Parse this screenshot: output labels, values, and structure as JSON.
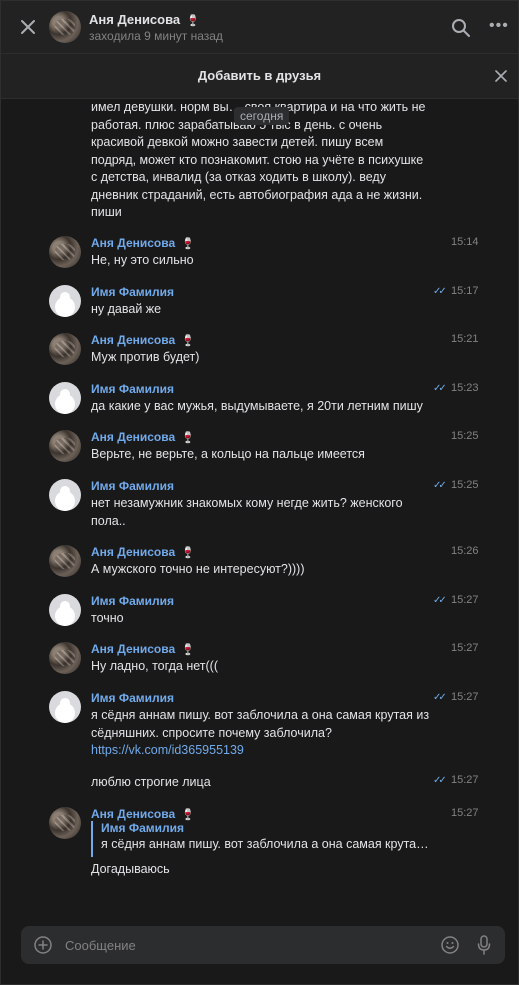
{
  "header": {
    "contact_name": "Аня Денисова",
    "status": "заходила 9 минут назад",
    "icons": {
      "close": "close-icon",
      "search": "search-icon",
      "more": "more-icon",
      "glass": "wine-glass-icon"
    }
  },
  "add_friend": {
    "label": "Добавить в друзья"
  },
  "date_badge": "сегодня",
  "first_text": "имел девушки. норм вы… своя квартира и на что жить не работая. плюс зарабатываю 5 тыс в день. с очень красивой девкой можно завести детей. пишу всем подряд, может кто познакомит. стою на учёте в психушке с детства, инвалид (за отказ ходить в школу). веду дневник страданий, есть автобиография ада а не жизни. пиши",
  "messages": [
    {
      "author": "Аня Денисова",
      "time": "15:14",
      "text": "Не, ну это сильно"
    },
    {
      "author": "Имя Фамилия",
      "time": "15:17",
      "text": "ну давай же"
    },
    {
      "author": "Аня Денисова",
      "time": "15:21",
      "text": "Муж против будет)"
    },
    {
      "author": "Имя Фамилия",
      "time": "15:23",
      "text": "да какие у вас мужья, выдумываете, я 20ти летним пишу"
    },
    {
      "author": "Аня Денисова",
      "time": "15:25",
      "text": "Верьте, не верьте, а кольцо на пальце имеется"
    },
    {
      "author": "Имя Фамилия",
      "time": "15:25",
      "text": "нет незамужник знакомых кому негде жить? женского пола.."
    },
    {
      "author": "Аня Денисова",
      "time": "15:26",
      "text": "А мужского точно не интересуют?))))"
    },
    {
      "author": "Имя Фамилия",
      "time": "15:27",
      "text": "точно"
    },
    {
      "author": "Аня Денисова",
      "time": "15:27",
      "text": "Ну ладно, тогда нет((("
    },
    {
      "author": "Имя Фамилия",
      "time": "15:27",
      "text": "я сёдня аннам пишу. вот заблочила а она самая крутая из сёдняшних. спросите почему заблочила?",
      "link": "https://vk.com/id365955139"
    },
    {
      "time": "15:27",
      "text": "люблю строгие лица"
    },
    {
      "author": "Аня Денисова",
      "time": "15:27",
      "reply_author": "Имя Фамилия",
      "reply_text": "я сёдня аннам пишу. вот заблочила а она самая крутая ...",
      "text": "Догадываюсь"
    }
  ],
  "composer": {
    "placeholder": "Сообщение"
  },
  "colors": {
    "background": "#19191a",
    "panel": "#222222",
    "accent": "#71aaeb",
    "text": "#e1e3e6",
    "muted": "#828282"
  }
}
